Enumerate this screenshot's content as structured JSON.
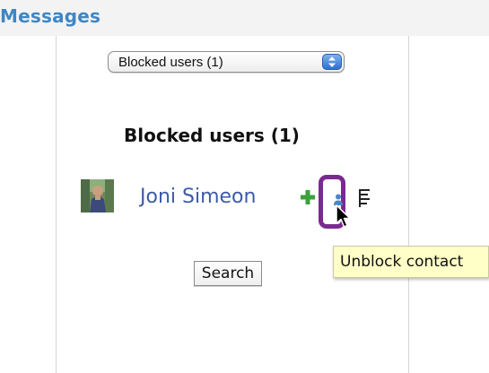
{
  "header": {
    "title": "Messages"
  },
  "filter": {
    "selected": "Blocked users (1)"
  },
  "section": {
    "heading": "Blocked users (1)"
  },
  "contacts": [
    {
      "name": "Joni Simeon",
      "actions": [
        "add-contact-icon",
        "unblock-contact-icon",
        "contact-details-icon"
      ]
    }
  ],
  "search": {
    "label": "Search"
  },
  "tooltip": {
    "text": "Unblock contact"
  },
  "colors": {
    "title": "#3f86c4",
    "contact_name": "#3c5aa8",
    "highlight_ring": "#7a2a8f",
    "tooltip_bg": "#ffffc8",
    "add_icon": "#3aa23a"
  }
}
